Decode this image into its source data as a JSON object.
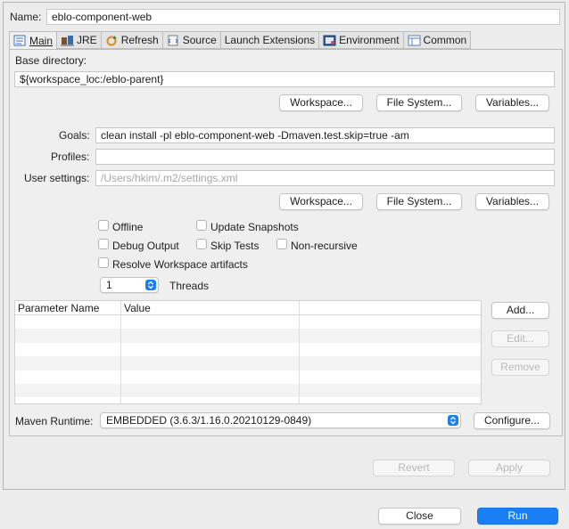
{
  "name": {
    "label": "Name:",
    "value": "eblo-component-web"
  },
  "tabs": [
    {
      "label": "Main",
      "icon": "main-tab-icon"
    },
    {
      "label": "JRE",
      "icon": "jre-icon"
    },
    {
      "label": "Refresh",
      "icon": "refresh-icon"
    },
    {
      "label": "Source",
      "icon": "source-icon"
    },
    {
      "label": "Launch Extensions",
      "icon": ""
    },
    {
      "label": "Environment",
      "icon": "environment-icon"
    },
    {
      "label": "Common",
      "icon": "common-icon"
    }
  ],
  "base_directory": {
    "label": "Base directory:",
    "value": "${workspace_loc:/eblo-parent}",
    "buttons": [
      "Workspace...",
      "File System...",
      "Variables..."
    ]
  },
  "goals": {
    "label": "Goals:",
    "value": "clean install -pl eblo-component-web -Dmaven.test.skip=true -am"
  },
  "profiles": {
    "label": "Profiles:",
    "value": ""
  },
  "user_settings": {
    "label": "User settings:",
    "placeholder": "/Users/hkim/.m2/settings.xml",
    "buttons": [
      "Workspace...",
      "File System...",
      "Variables..."
    ]
  },
  "options": {
    "offline": "Offline",
    "update_snapshots": "Update Snapshots",
    "debug_output": "Debug Output",
    "skip_tests": "Skip Tests",
    "non_recursive": "Non-recursive",
    "resolve_workspace": "Resolve Workspace artifacts"
  },
  "threads": {
    "value": "1",
    "label": "Threads"
  },
  "parameters": {
    "columns": [
      "Parameter Name",
      "Value"
    ],
    "add": "Add...",
    "edit": "Edit...",
    "remove": "Remove"
  },
  "maven_runtime": {
    "label": "Maven Runtime:",
    "value": "EMBEDDED (3.6.3/1.16.0.20210129-0849)",
    "configure": "Configure..."
  },
  "revert": "Revert",
  "apply": "Apply",
  "close": "Close",
  "run": "Run",
  "colors": {
    "accent": "#1a7ff5"
  }
}
